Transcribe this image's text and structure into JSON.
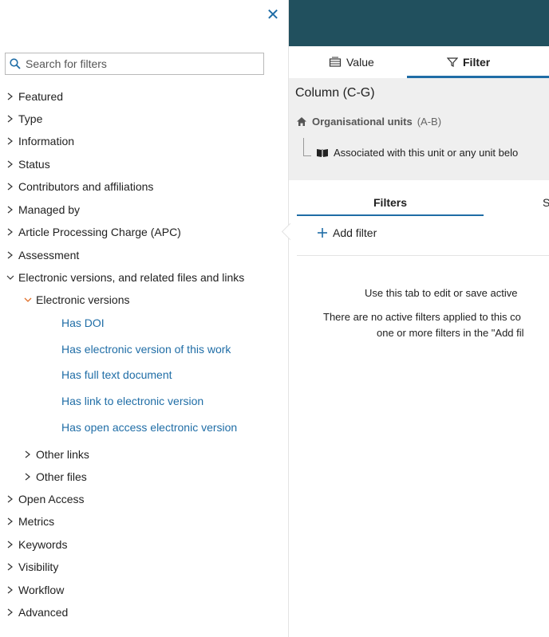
{
  "left_panel": {
    "search_placeholder": "Search for filters",
    "items": [
      {
        "label": "Featured"
      },
      {
        "label": "Type"
      },
      {
        "label": "Information"
      },
      {
        "label": "Status"
      },
      {
        "label": "Contributors and affiliations"
      },
      {
        "label": "Managed by"
      },
      {
        "label": "Article Processing Charge (APC)"
      },
      {
        "label": "Assessment"
      },
      {
        "label": "Electronic versions, and related files and links"
      },
      {
        "label": "Electronic versions"
      },
      {
        "label": "Has DOI"
      },
      {
        "label": "Has electronic version of this work"
      },
      {
        "label": "Has full text document"
      },
      {
        "label": "Has link to electronic version"
      },
      {
        "label": "Has open access electronic version"
      },
      {
        "label": "Other links"
      },
      {
        "label": "Other files"
      },
      {
        "label": "Open Access"
      },
      {
        "label": "Metrics"
      },
      {
        "label": "Keywords"
      },
      {
        "label": "Visibility"
      },
      {
        "label": "Workflow"
      },
      {
        "label": "Advanced"
      }
    ]
  },
  "right_panel": {
    "tabs": {
      "value": "Value",
      "filter": "Filter"
    },
    "column_title": "Column (C-G)",
    "org_units_label": "Organisational units",
    "org_units_range": "(A-B)",
    "associated_text": "Associated with this unit or any unit belo",
    "subtabs": {
      "filters": "Filters",
      "second": "S"
    },
    "add_filter": "Add filter",
    "message_line1": "Use this tab to edit or save active",
    "message_line2": "There are no active filters applied to this co",
    "message_line3": "one or more filters in the \"Add fil"
  },
  "colors": {
    "accent": "#1f6da6",
    "header": "#21505e",
    "expanded_chevron": "#e0702a"
  }
}
